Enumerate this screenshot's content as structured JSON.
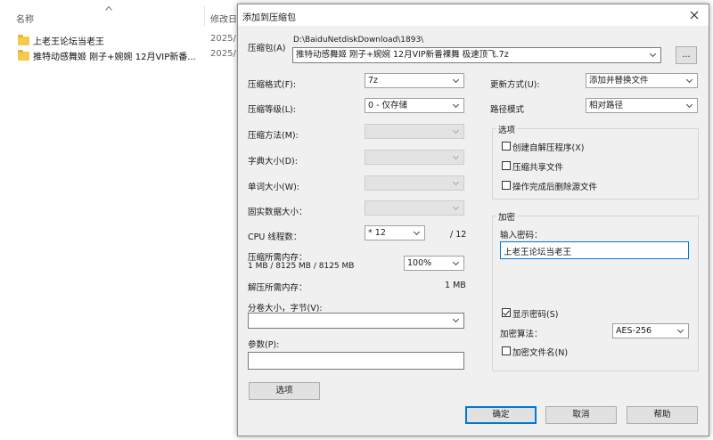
{
  "explorer": {
    "col_name": "名称",
    "col_modified": "修改日",
    "rows": [
      {
        "name": "上老王论坛当老王",
        "date": "2025/"
      },
      {
        "name": "推特动感舞姬 刚子+婉婉 12月VIP新番...",
        "date": "2025/"
      }
    ]
  },
  "dialog": {
    "title": "添加到压缩包",
    "close_icon": "close-icon",
    "archive_label": "压缩包(A)",
    "archive_path": "D:\\BaiduNetdiskDownload\\1893\\",
    "archive_name": "推特动感舞姬 刚子+婉婉 12月VIP新番裸舞 极速顶飞.7z",
    "browse_label": "...",
    "left": {
      "format_label": "压缩格式(F):",
      "format_value": "7z",
      "level_label": "压缩等级(L):",
      "level_value": "0 - 仅存储",
      "method_label": "压缩方法(M):",
      "dict_label": "字典大小(D):",
      "word_label": "单词大小(W):",
      "solid_label": "固实数据大小：",
      "cpu_label": "CPU 线程数：",
      "cpu_value": "* 12",
      "cpu_max": "/ 12",
      "mem_label": "压缩所需内存：",
      "mem_detail": "1 MB / 8125 MB / 8125 MB",
      "mem_percent": "100%",
      "decomp_label": "解压所需内存：",
      "decomp_value": "1 MB",
      "split_label": "分卷大小，字节(V):",
      "params_label": "参数(P):",
      "options_button": "选项"
    },
    "right": {
      "update_label": "更新方式(U):",
      "update_value": "添加并替换文件",
      "path_label": "路径模式",
      "path_value": "相对路径",
      "options_group": "选项",
      "opt_sfx": "创建自解压程序(X)",
      "opt_shared": "压缩共享文件",
      "opt_delete": "操作完成后删除源文件",
      "encrypt_group": "加密",
      "password_label": "输入密码：",
      "password_value": "上老王论坛当老王",
      "show_password": "显示密码(S)",
      "algo_label": "加密算法：",
      "algo_value": "AES-256",
      "encrypt_names": "加密文件名(N)"
    },
    "buttons": {
      "ok": "确定",
      "cancel": "取消",
      "help": "帮助"
    },
    "checks": {
      "sfx": false,
      "shared": false,
      "delete": false,
      "show_password": true,
      "encrypt_names": false
    }
  }
}
